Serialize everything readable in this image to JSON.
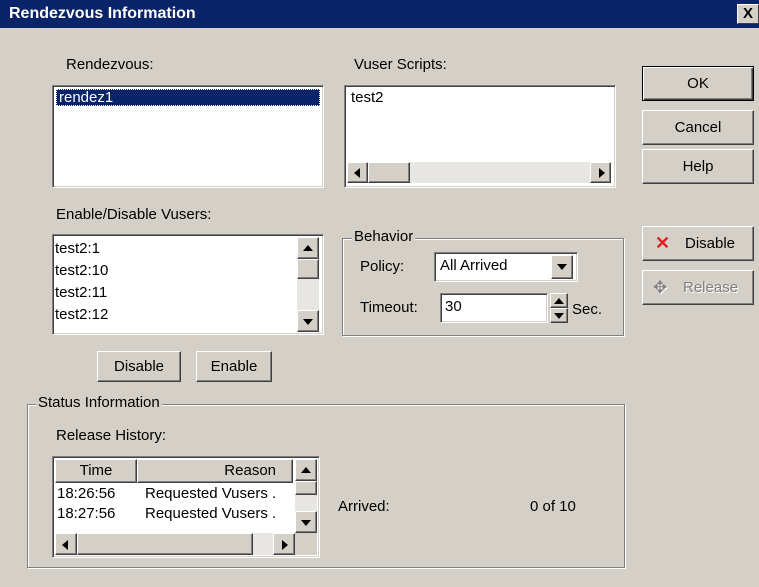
{
  "window": {
    "title": "Rendezvous Information",
    "close_glyph": "X"
  },
  "rendezvous": {
    "label": "Rendezvous:",
    "items": [
      "rendez1"
    ],
    "selected_index": 0
  },
  "vuser_scripts": {
    "label": "Vuser Scripts:",
    "items": [
      "test2"
    ]
  },
  "enable_disable": {
    "label": "Enable/Disable Vusers:",
    "items": [
      "test2:1",
      "test2:10",
      "test2:11",
      "test2:12"
    ],
    "disable_label": "Disable",
    "enable_label": "Enable"
  },
  "behavior": {
    "title": "Behavior",
    "policy_label": "Policy:",
    "policy_value": "All Arrived",
    "timeout_label": "Timeout:",
    "timeout_value": "30",
    "timeout_unit": "Sec."
  },
  "side_buttons": {
    "ok": "OK",
    "cancel": "Cancel",
    "help": "Help",
    "disable": "Disable",
    "release": "Release"
  },
  "status": {
    "title": "Status Information",
    "release_history_label": "Release History:",
    "columns": [
      "Time",
      "Reason"
    ],
    "rows": [
      {
        "time": "18:26:56",
        "reason": "Requested Vusers ."
      },
      {
        "time": "18:27:56",
        "reason": "Requested Vusers ."
      }
    ],
    "arrived_label": "Arrived:",
    "arrived_value": "0 of 10"
  },
  "icons": {
    "disable": "red-x-icon",
    "release": "release-arrows-icon",
    "disable_color": "#e02020"
  }
}
